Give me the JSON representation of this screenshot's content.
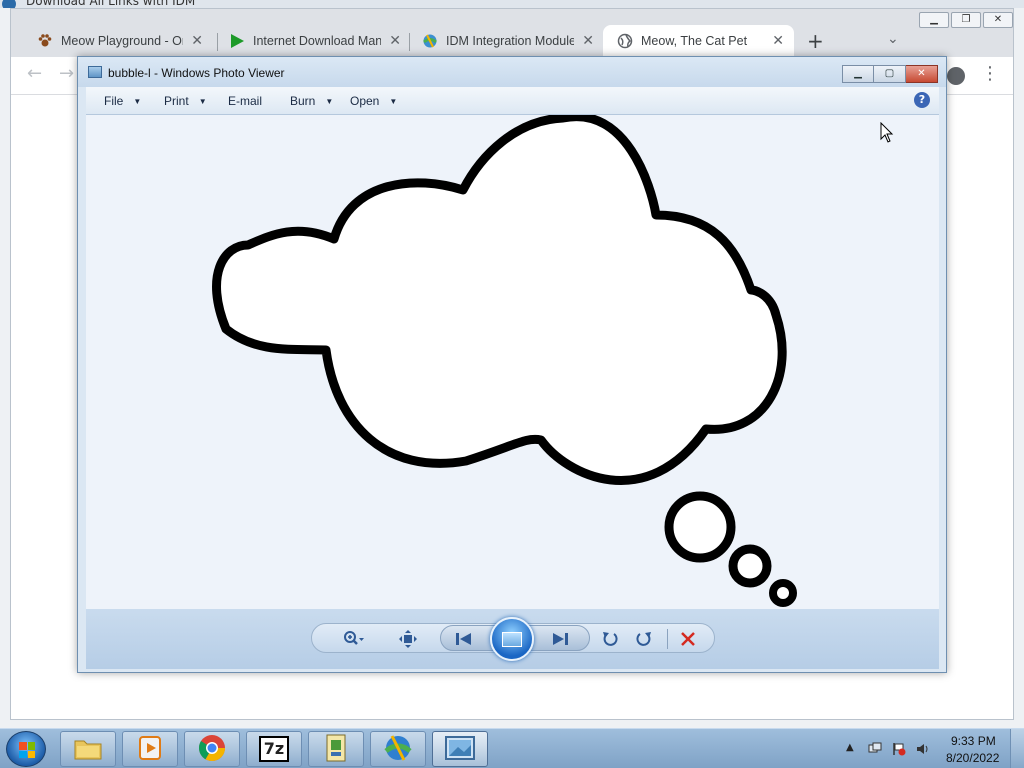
{
  "background_window": {
    "title": "Download All Links with IDM"
  },
  "browser": {
    "tabs": [
      {
        "label": "Meow Playground - Onl",
        "icon": "paw-icon"
      },
      {
        "label": "Internet Download Man",
        "icon": "play-arrow-icon"
      },
      {
        "label": "IDM Integration Module",
        "icon": "globe-download-icon"
      },
      {
        "label": "Meow, The Cat Pet",
        "icon": "globe-icon"
      }
    ],
    "active_tab_index": 3,
    "close_glyph": "✕",
    "new_tab_glyph": "+",
    "back_glyph": "←",
    "forward_glyph": "→"
  },
  "photo_viewer": {
    "title": "bubble-l - Windows Photo Viewer",
    "menu": [
      {
        "label": "File",
        "has_caret": true
      },
      {
        "label": "Print",
        "has_caret": true
      },
      {
        "label": "E-mail",
        "has_caret": false
      },
      {
        "label": "Burn",
        "has_caret": true
      },
      {
        "label": "Open",
        "has_caret": true
      }
    ],
    "help_glyph": "?",
    "image_subject": "thought-bubble",
    "colors": {
      "canvas": "#eef3fa",
      "stroke": "#000000",
      "fill": "#ffffff",
      "delete": "#d42a20",
      "control_icon": "#2f5a96"
    }
  },
  "taskbar": {
    "items": [
      {
        "name": "windows-explorer",
        "icon": "folder-icon"
      },
      {
        "name": "media-player",
        "icon": "media-player-icon"
      },
      {
        "name": "chrome",
        "icon": "chrome-icon"
      },
      {
        "name": "7zip",
        "icon": "7zip-icon",
        "label": "7z"
      },
      {
        "name": "installer",
        "icon": "installer-icon"
      },
      {
        "name": "idm",
        "icon": "idm-icon"
      },
      {
        "name": "photo-viewer",
        "icon": "photo-viewer-icon",
        "active": true
      }
    ],
    "clock": {
      "time": "9:33 PM",
      "date": "8/20/2022"
    }
  }
}
